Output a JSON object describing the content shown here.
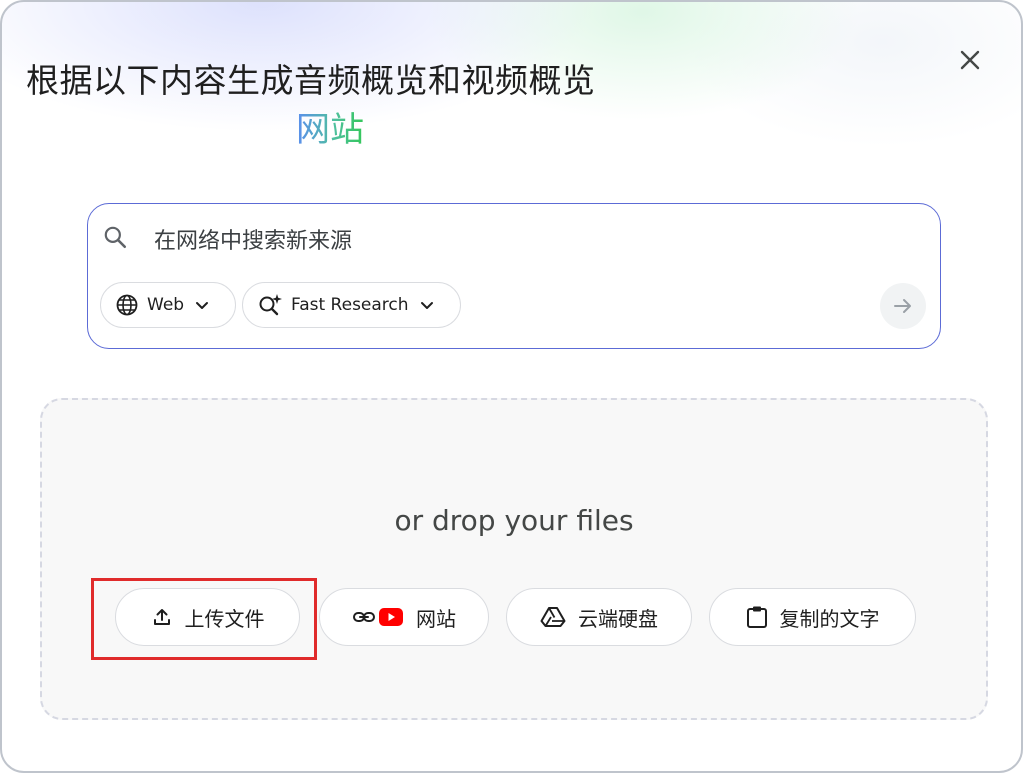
{
  "dialog": {
    "title": "根据以下内容生成音频概览和视频概览",
    "subtitle": "网站"
  },
  "search": {
    "placeholder": "在网络中搜索新来源",
    "value": "",
    "source_chip_label": "Web",
    "mode_chip_label": "Fast Research"
  },
  "drop_zone": {
    "text": "or drop your files",
    "buttons": {
      "upload": "上传文件",
      "website": "网站",
      "drive": "云端硬盘",
      "paste_text": "复制的文字"
    }
  },
  "icons": {
    "close": "close-icon",
    "search": "search-icon",
    "globe": "globe-icon",
    "sparkle_search": "sparkle-search-icon",
    "chevron": "chevron-down-icon",
    "submit": "arrow-right-icon",
    "upload": "upload-icon",
    "link": "link-icon",
    "youtube": "youtube-icon",
    "drive": "drive-icon",
    "clipboard": "clipboard-icon"
  },
  "colors": {
    "accent_border": "#5c6bd6",
    "highlight": "#e02b2b",
    "youtube_red": "#ff0000"
  }
}
